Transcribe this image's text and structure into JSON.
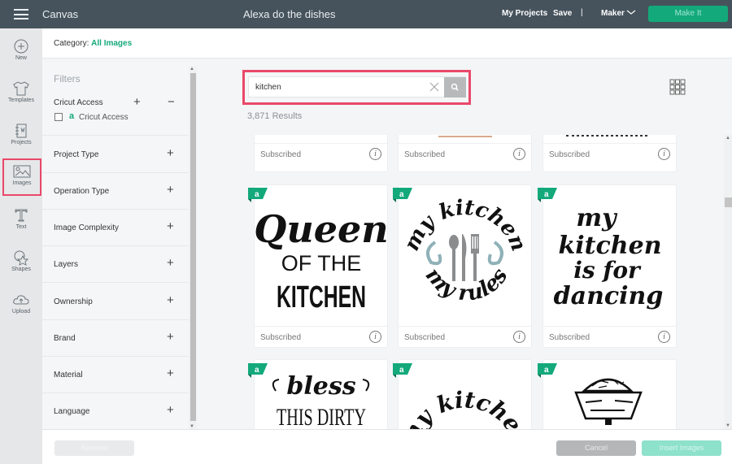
{
  "topbar": {
    "app_name": "Canvas",
    "document_title": "Alexa do the dishes",
    "my_projects": "My Projects",
    "save": "Save",
    "separator": "|",
    "machine": "Maker",
    "make_it": "Make It"
  },
  "left_rail": [
    {
      "label": "New",
      "icon": "plus-circle-icon"
    },
    {
      "label": "Templates",
      "icon": "tshirt-icon"
    },
    {
      "label": "Projects",
      "icon": "notebook-icon"
    },
    {
      "label": "Images",
      "icon": "image-icon",
      "active": true
    },
    {
      "label": "Text",
      "icon": "text-icon"
    },
    {
      "label": "Shapes",
      "icon": "shapes-icon"
    },
    {
      "label": "Upload",
      "icon": "cloud-upload-icon"
    }
  ],
  "category": {
    "label": "Category:",
    "value": "All Images"
  },
  "filters": {
    "title": "Filters",
    "cricut_access": {
      "heading": "Cricut Access",
      "checkbox_label": "Cricut Access",
      "checked": false
    },
    "groups": [
      "Project Type",
      "Operation Type",
      "Image Complexity",
      "Layers",
      "Ownership",
      "Brand",
      "Material",
      "Language"
    ]
  },
  "search": {
    "value": "kitchen",
    "results": "3,871 Results"
  },
  "cards": [
    {
      "status": "Subscribed",
      "art": "partial-top"
    },
    {
      "status": "Subscribed",
      "art": "partial-top"
    },
    {
      "status": "Subscribed",
      "art": "partial-top"
    },
    {
      "status": "Subscribed",
      "art": [
        "Queen",
        "OF THE",
        "KITCHEN"
      ],
      "access_badge": true
    },
    {
      "status": "Subscribed",
      "art": [
        "my kitchen",
        "my rules"
      ],
      "access_badge": true
    },
    {
      "status": "Subscribed",
      "art": [
        "my",
        "kitchen",
        "is for",
        "dancing"
      ],
      "access_badge": true
    },
    {
      "status": "",
      "art": [
        "bless",
        "THIS DIRTY"
      ],
      "access_badge": true
    },
    {
      "status": "",
      "art": [
        "my kitchen"
      ],
      "access_badge": true
    },
    {
      "status": "",
      "art": "kitchen-scale",
      "access_badge": true
    }
  ],
  "bottom": {
    "remove": "Remove",
    "cancel": "Cancel",
    "insert": "Insert Images"
  }
}
